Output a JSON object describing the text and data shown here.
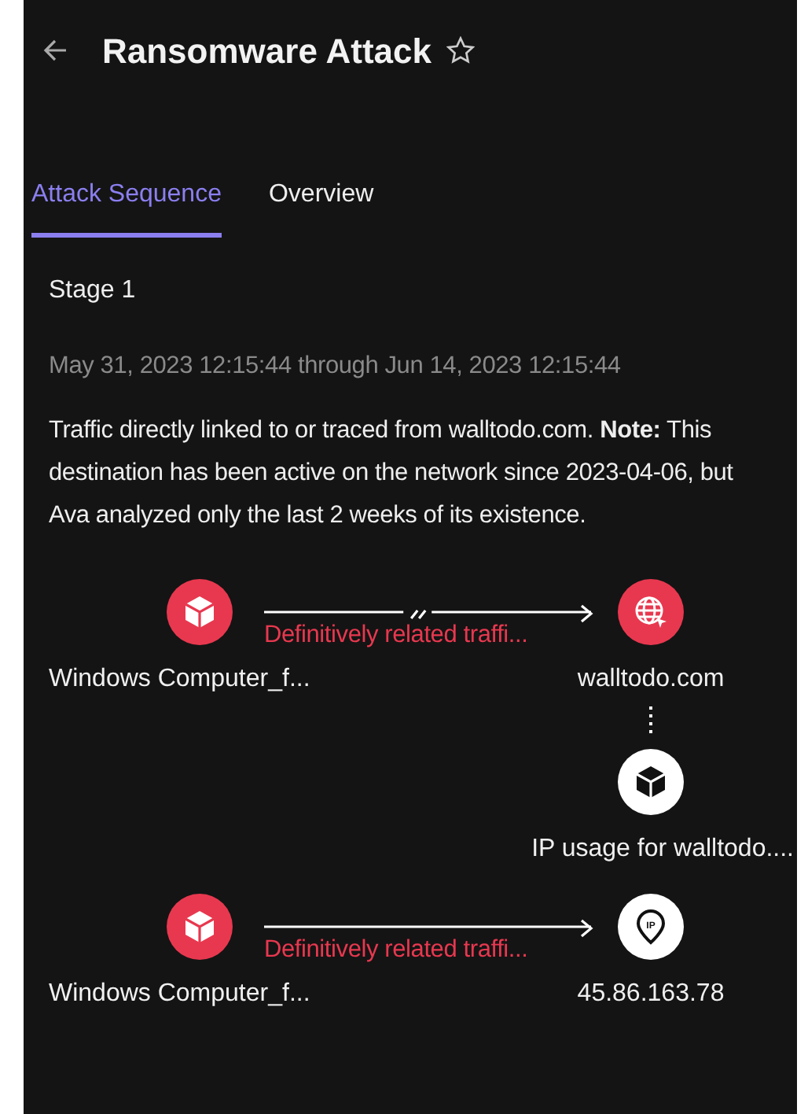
{
  "header": {
    "title": "Ransomware Attack",
    "starred": false
  },
  "tabs": [
    {
      "label": "Attack Sequence",
      "selected": true
    },
    {
      "label": "Overview",
      "selected": false
    }
  ],
  "stage": {
    "title": "Stage 1",
    "date_range": "May 31, 2023 12:15:44 through Jun 14, 2023 12:15:44",
    "description": "Traffic directly linked to or traced from walltodo.com. **Note:** This destination has been active on the network since 2023-04-06, but Ava analyzed only the last 2 weeks of its existence."
  },
  "graph": {
    "nodes": [
      {
        "label": "Windows Computer_f...",
        "kind": "device",
        "color": "#e8384f"
      },
      {
        "label": "walltodo.com",
        "kind": "domain",
        "color": "#e8384f"
      },
      {
        "label": "IP usage for walltodo....",
        "kind": "ip_usage",
        "color": "#ffffff"
      },
      {
        "label": "Windows Computer_f...",
        "kind": "device",
        "color": "#e8384f"
      },
      {
        "label": "45.86.163.78",
        "kind": "ip",
        "color": "#ffffff",
        "icon_text": "IP"
      }
    ],
    "edges": [
      {
        "kind": "arrow",
        "label": "Definitively related traffi...",
        "broken": true
      },
      {
        "kind": "dotted"
      },
      {
        "kind": "arrow",
        "label": "Definitively related traffi...",
        "broken": false
      }
    ]
  }
}
